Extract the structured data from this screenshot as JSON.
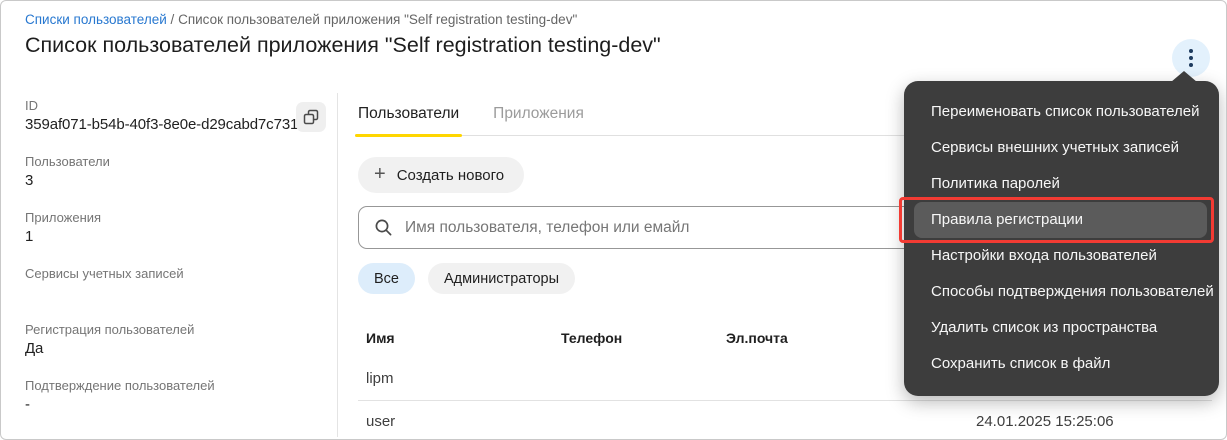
{
  "breadcrumb": {
    "link": "Списки пользователей",
    "separator": "/",
    "current": "Список пользователей приложения \"Self registration testing-dev\""
  },
  "page": {
    "title": "Список пользователей приложения \"Self registration testing-dev\""
  },
  "details": {
    "fields": [
      {
        "label": "ID",
        "value": "359af071-b54b-40f3-8e0e-d29cabd7c731"
      },
      {
        "label": "Пользователи",
        "value": "3"
      },
      {
        "label": "Приложения",
        "value": "1"
      },
      {
        "label": "Сервисы учетных записей",
        "value": ""
      },
      {
        "label": "Регистрация пользователей",
        "value": "Да"
      },
      {
        "label": "Подтверждение пользователей",
        "value": "-"
      }
    ]
  },
  "tabs": [
    {
      "label": "Пользователи",
      "active": true
    },
    {
      "label": "Приложения",
      "active": false
    }
  ],
  "toolbar": {
    "create_label": "Создать нового"
  },
  "search": {
    "placeholder": "Имя пользователя, телефон или емайл"
  },
  "filters": [
    {
      "label": "Все",
      "active": true
    },
    {
      "label": "Администраторы",
      "active": false
    }
  ],
  "table": {
    "headers": [
      "Имя",
      "Телефон",
      "Эл.почта"
    ],
    "rows": [
      {
        "name": "lipm",
        "phone": "",
        "email": "",
        "date": ""
      },
      {
        "name": "user",
        "phone": "",
        "email": "",
        "date": "24.01.2025 15:25:06"
      }
    ]
  },
  "menu": {
    "items": [
      {
        "label": "Переименовать список пользователей",
        "highlighted": false
      },
      {
        "label": "Сервисы внешних учетных записей",
        "highlighted": false
      },
      {
        "label": "Политика паролей",
        "highlighted": false
      },
      {
        "label": "Правила регистрации",
        "highlighted": true
      },
      {
        "label": "Настройки входа пользователей",
        "highlighted": false
      },
      {
        "label": "Способы подтверждения пользователей",
        "highlighted": false
      },
      {
        "label": "Удалить список из пространства",
        "highlighted": false
      },
      {
        "label": "Сохранить список в файл",
        "highlighted": false
      }
    ]
  },
  "icons": {
    "kebab": "kebab-menu-icon",
    "copy": "copy-icon",
    "search": "search-icon",
    "plus": "plus-icon"
  },
  "colors": {
    "accent_yellow": "#ffd600",
    "link_blue": "#2878d0",
    "menu_bg": "#3d3d3d",
    "menu_highlight_bg": "#5b5b5b",
    "annotation_red": "#f23b33",
    "chip_active_blue": "#ddedfb",
    "kebab_circle_blue": "#e3f1fc"
  }
}
